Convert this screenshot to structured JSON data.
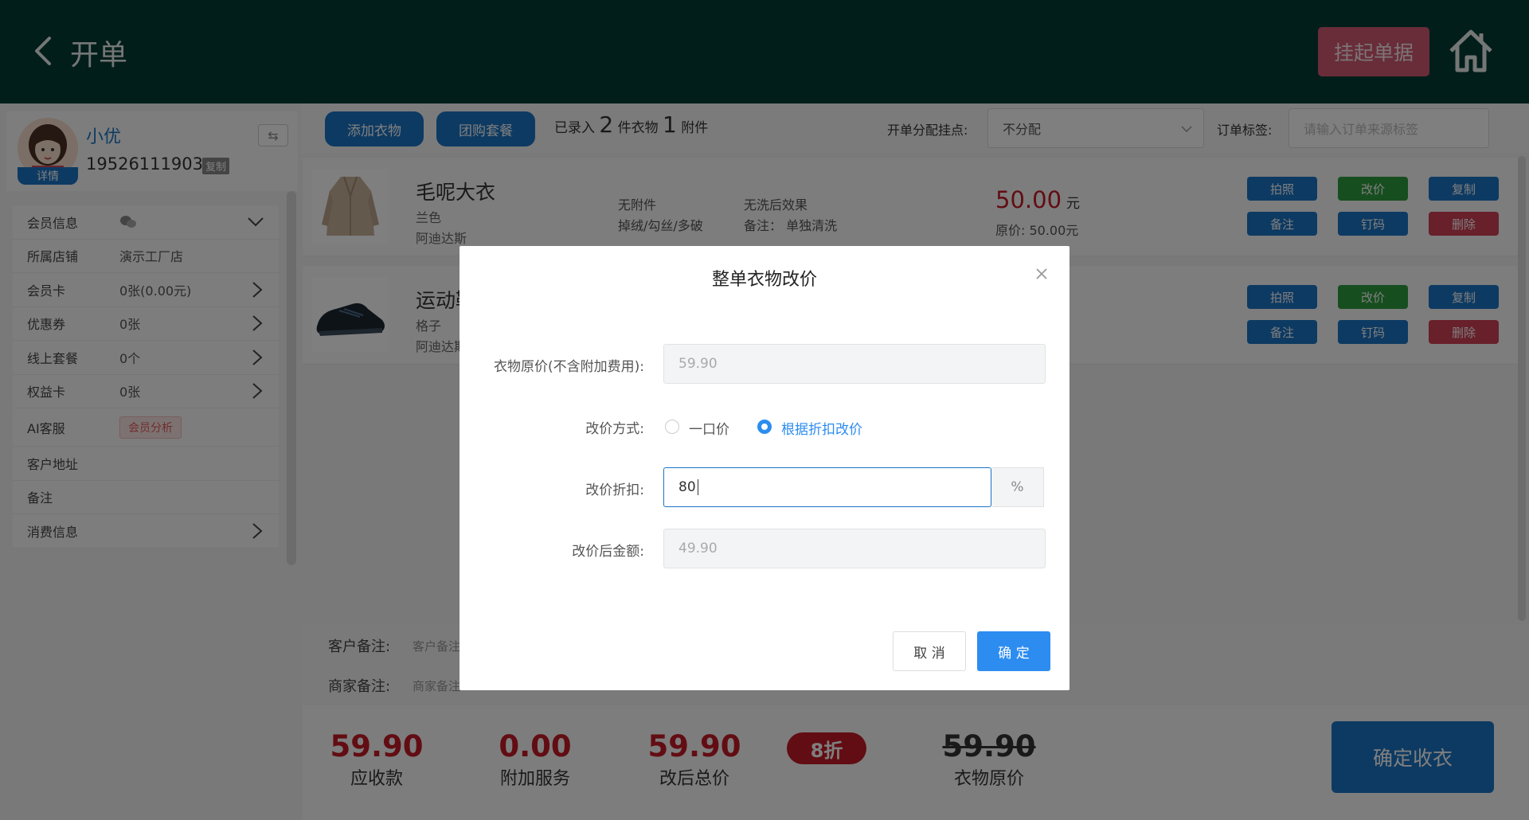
{
  "header": {
    "title": "开单",
    "suspend_label": "挂起单据"
  },
  "member": {
    "name": "小优",
    "phone": "19526111903",
    "copy_label": "复制",
    "detail_label": "详情",
    "switch_icon": "⇆",
    "rows": [
      {
        "label": "会员信息",
        "value": "",
        "has_chevron_down": true
      },
      {
        "label": "所属店铺",
        "value": "演示工厂店"
      },
      {
        "label": "会员卡",
        "value": "0张(0.00元)"
      },
      {
        "label": "优惠券",
        "value": "0张"
      },
      {
        "label": "线上套餐",
        "value": "0个"
      },
      {
        "label": "权益卡",
        "value": "0张"
      },
      {
        "label": "AI客服",
        "tag": "会员分析"
      },
      {
        "label": "客户地址",
        "value": ""
      },
      {
        "label": "备注",
        "value": ""
      },
      {
        "label": "消费信息",
        "value": ""
      }
    ]
  },
  "toolbar": {
    "add_clothes": "添加衣物",
    "group_package": "团购套餐",
    "entered_prefix": "已录入",
    "clothes_count": "2",
    "clothes_suffix": "件衣物",
    "attachment_count": "1",
    "attachment_suffix": "附件",
    "assign_label": "开单分配挂点:",
    "assign_value": "不分配",
    "tag_label": "订单标签:",
    "tag_placeholder": "请输入订单来源标签"
  },
  "items": [
    {
      "name": "毛呢大衣",
      "color": "兰色",
      "brand": "阿迪达斯",
      "attachment": "无附件",
      "defect": "掉绒/勾丝/多破",
      "effect": "无洗后效果",
      "note": "备注： 单独清洗",
      "price": "50.00",
      "price_unit": "元",
      "original": "原价: 50.00元"
    },
    {
      "name": "运动鞋",
      "color": "格子",
      "brand": "阿迪达斯"
    }
  ],
  "item_actions": {
    "photo": "拍照",
    "reprice": "改价",
    "copy": "复制",
    "remark": "备注",
    "nail": "钉码",
    "delete": "删除"
  },
  "remarks": {
    "customer_label": "客户备注:",
    "customer_placeholder": "客户备注",
    "merchant_label": "商家备注:",
    "merchant_placeholder": "商家备注"
  },
  "summary": {
    "receivable": "59.90",
    "receivable_label": "应收款",
    "addon": "0.00",
    "addon_label": "附加服务",
    "after_total": "59.90",
    "after_total_label": "改后总价",
    "discount_badge": "8折",
    "original": "59.90",
    "original_label": "衣物原价",
    "confirm_label": "确定收衣"
  },
  "modal": {
    "title": "整单衣物改价",
    "original_label": "衣物原价(不含附加费用):",
    "original_value": "59.90",
    "method_label": "改价方式:",
    "method_options": [
      "一口价",
      "根据折扣改价"
    ],
    "method_selected": "根据折扣改价",
    "discount_label": "改价折扣:",
    "discount_value": "80",
    "discount_suffix": "%",
    "after_label": "改价后金额:",
    "after_value": "49.90",
    "cancel_label": "取 消",
    "ok_label": "确 定"
  },
  "colors": {
    "header_bg": "#043c35",
    "primary": "#1b74c4",
    "modal_primary": "#2d8cf0",
    "price_red": "#c41a26",
    "suspend_btn": "#d05a72",
    "green_btn": "#2e9c3e",
    "delete_btn": "#d04057"
  }
}
